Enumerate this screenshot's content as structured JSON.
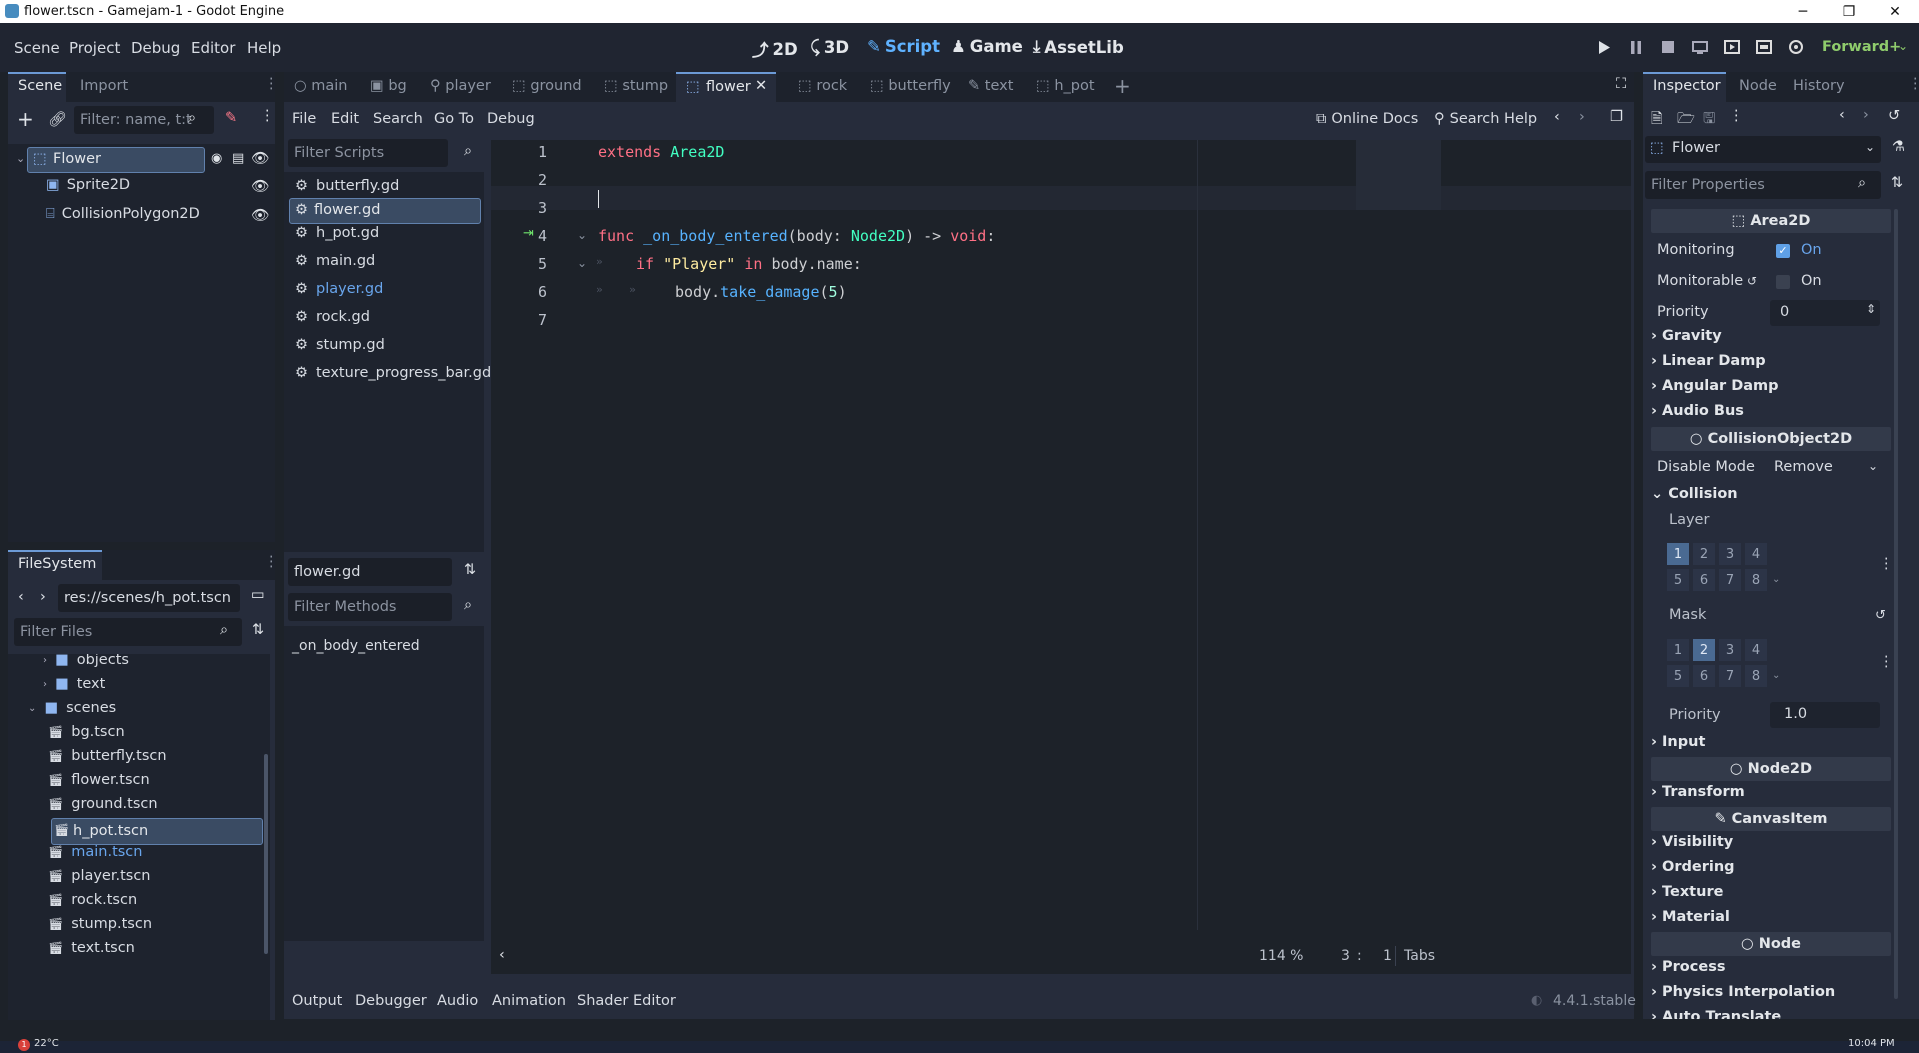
{
  "window": {
    "title": "flower.tscn - Gamejam-1 - Godot Engine",
    "minimize": "─",
    "maximize": "❐",
    "close": "✕"
  },
  "menubar": {
    "items": [
      "Scene",
      "Project",
      "Debug",
      "Editor",
      "Help"
    ],
    "workspaces": {
      "w2d": "2D",
      "w3d": "3D",
      "script": "Script",
      "game": "Game",
      "assetlib": "AssetLib"
    },
    "renderer": "Forward+"
  },
  "scene_dock": {
    "tabs": [
      "Scene",
      "Import"
    ],
    "filter_placeholder": "Filter: name, t:t",
    "nodes": [
      {
        "name": "Flower"
      },
      {
        "name": "Sprite2D"
      },
      {
        "name": "CollisionPolygon2D"
      }
    ]
  },
  "filesystem": {
    "title": "FileSystem",
    "path": "res://scenes/h_pot.tscn",
    "filter_placeholder": "Filter Files",
    "items": [
      {
        "name": "objects",
        "type": "folder"
      },
      {
        "name": "text",
        "type": "folder"
      },
      {
        "name": "scenes",
        "type": "folder"
      },
      {
        "name": "bg.tscn"
      },
      {
        "name": "butterfly.tscn"
      },
      {
        "name": "flower.tscn"
      },
      {
        "name": "ground.tscn"
      },
      {
        "name": "h_pot.tscn"
      },
      {
        "name": "main.tscn"
      },
      {
        "name": "player.tscn"
      },
      {
        "name": "rock.tscn"
      },
      {
        "name": "stump.tscn"
      },
      {
        "name": "text.tscn"
      }
    ]
  },
  "scene_tabs": [
    "main",
    "bg",
    "player",
    "ground",
    "stump",
    "flower",
    "rock",
    "butterfly",
    "text",
    "h_pot"
  ],
  "script_menu": {
    "items": [
      "File",
      "Edit",
      "Search",
      "Go To",
      "Debug"
    ],
    "online_docs": "Online Docs",
    "search_help": "Search Help"
  },
  "scripts": {
    "filter_placeholder": "Filter Scripts",
    "items": [
      "butterfly.gd",
      "flower.gd",
      "h_pot.gd",
      "main.gd",
      "player.gd",
      "rock.gd",
      "stump.gd",
      "texture_progress_bar.gd"
    ],
    "current": "flower.gd",
    "methods_placeholder": "Filter Methods",
    "methods": [
      "_on_body_entered"
    ]
  },
  "editor": {
    "line_numbers": [
      "1",
      "2",
      "3",
      "4",
      "5",
      "6",
      "7"
    ],
    "code": {
      "l1a": "extends",
      "l1b": "Area2D",
      "l4a": "func",
      "l4b": "_on_body_entered",
      "l4c": "(body: ",
      "l4d": "Node2D",
      ") -> ": "",
      "l4e": ") ->",
      "l4f": "void",
      "l4g": ":",
      "l5a": "if",
      "l5b": "\"Player\"",
      "l5c": "in",
      "l5d": "body.name:",
      "l6a": "body.",
      "l6b": "take_damage",
      "l6c": "(",
      "l6d": "5",
      "l6e": ")"
    },
    "zoom": "114 %",
    "cursor_line": "3",
    "cursor_sep": ":",
    "cursor_col": "1",
    "indent": "Tabs"
  },
  "bottom_panel": {
    "tabs": [
      "Output",
      "Debugger",
      "Audio",
      "Animation",
      "Shader Editor"
    ],
    "version": "4.4.1.stable"
  },
  "inspector": {
    "tabs": [
      "Inspector",
      "Node",
      "History"
    ],
    "object": "Flower",
    "filter_placeholder": "Filter Properties",
    "area2d": "Area2D",
    "monitoring": "Monitoring",
    "monitoring_val": "On",
    "monitorable": "Monitorable",
    "monitorable_val": "On",
    "priority": "Priority",
    "priority_val": "0",
    "sections1": [
      "Gravity",
      "Linear Damp",
      "Angular Damp",
      "Audio Bus"
    ],
    "collisionobject": "CollisionObject2D",
    "disable_mode": "Disable Mode",
    "disable_mode_val": "Remove",
    "collision": "Collision",
    "layer": "Layer",
    "mask": "Mask",
    "bits_row1": [
      "1",
      "2",
      "3",
      "4"
    ],
    "bits_row2": [
      "5",
      "6",
      "7",
      "8"
    ],
    "layer_on": [
      1
    ],
    "mask_on": [
      2
    ],
    "priority2_val": "1.0",
    "input": "Input",
    "node2d": "Node2D",
    "transform": "Transform",
    "canvasitem": "CanvasItem",
    "sections2": [
      "Visibility",
      "Ordering",
      "Texture",
      "Material"
    ],
    "node": "Node",
    "sections3": [
      "Process",
      "Physics Interpolation",
      "Auto Translate"
    ]
  },
  "taskbar": {
    "weather": "22°C",
    "badge": "1",
    "time": "10:04 PM"
  }
}
